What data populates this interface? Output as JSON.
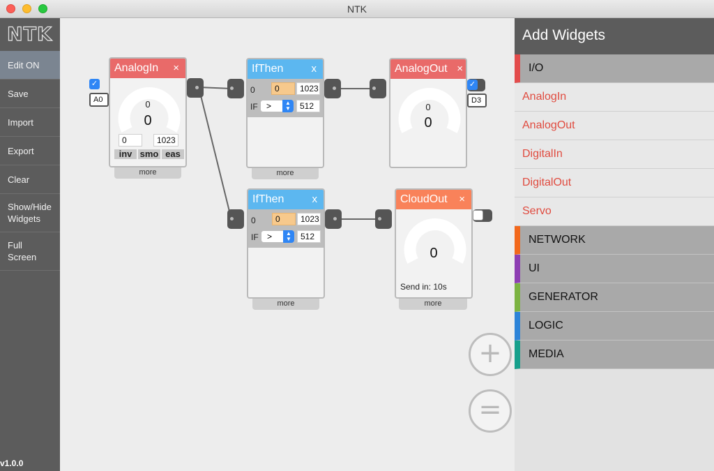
{
  "window": {
    "title": "NTK"
  },
  "sidebar": {
    "logo": "NTK",
    "items": [
      {
        "label": "Edit ON",
        "active": true
      },
      {
        "label": "Save"
      },
      {
        "label": "Import"
      },
      {
        "label": "Export"
      },
      {
        "label": "Clear"
      },
      {
        "label": "Show/Hide Widgets"
      },
      {
        "label": "Full Screen"
      }
    ],
    "version": "v1.0.0"
  },
  "canvas": {
    "analogin": {
      "title": "AnalogIn",
      "close": "×",
      "value_small": "0",
      "value_big": "0",
      "min": "0",
      "max": "1023",
      "buttons": [
        "inv",
        "smo",
        "eas"
      ],
      "more": "more",
      "pin": "A0",
      "checked": true
    },
    "ifthen1": {
      "title": "IfThen",
      "close": "x",
      "input": "0",
      "value": "0",
      "max": "1023",
      "if_label": "IF",
      "operator": ">",
      "threshold": "512",
      "more": "more"
    },
    "analogout": {
      "title": "AnalogOut",
      "close": "×",
      "value_small": "0",
      "value_big": "0",
      "pin": "D3",
      "checked": true
    },
    "ifthen2": {
      "title": "IfThen",
      "close": "x",
      "input": "0",
      "value": "0",
      "max": "1023",
      "if_label": "IF",
      "operator": ">",
      "threshold": "512",
      "more": "more"
    },
    "cloudout": {
      "title": "CloudOut",
      "close": "×",
      "value_big": "0",
      "send_in": "Send in: 10s",
      "more": "more",
      "checked": false
    },
    "plus_button": "+",
    "equal_button": "="
  },
  "add_widgets": {
    "title": "Add Widgets",
    "categories": [
      {
        "label": "I/O",
        "color": "#e34c4c",
        "items": [
          "AnalogIn",
          "AnalogOut",
          "DigitalIn",
          "DigitalOut",
          "Servo"
        ]
      },
      {
        "label": "NETWORK",
        "color": "#f2681c"
      },
      {
        "label": "UI",
        "color": "#8e3fb3"
      },
      {
        "label": "GENERATOR",
        "color": "#7cb342"
      },
      {
        "label": "LOGIC",
        "color": "#2d84d8"
      },
      {
        "label": "MEDIA",
        "color": "#16a08c"
      }
    ]
  }
}
